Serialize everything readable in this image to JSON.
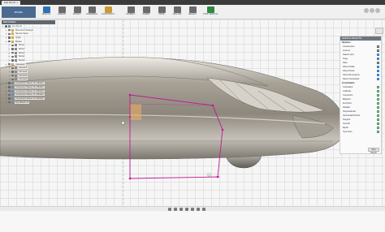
{
  "document_tab": {
    "title": "Fun Kit v9",
    "close": "×"
  },
  "toolbar": {
    "workspace": "MODEL",
    "tools": [
      {
        "label": "SKETCH",
        "icon": "sketch-icon",
        "color": "#2b72b8"
      },
      {
        "label": "CREATE",
        "icon": "create-icon",
        "color": "#6a6a6a"
      },
      {
        "label": "MODIFY",
        "icon": "modify-icon",
        "color": "#6a6a6a"
      },
      {
        "label": "ASSEMBLE",
        "icon": "assemble-icon",
        "color": "#6a6a6a"
      },
      {
        "label": "CONSTRUCT",
        "icon": "construct-icon",
        "color": "#c79a34"
      },
      {
        "label": "INSPECT",
        "icon": "inspect-icon",
        "color": "#6a6a6a"
      },
      {
        "label": "INSERT",
        "icon": "insert-icon",
        "color": "#6a6a6a"
      },
      {
        "label": "MAKE",
        "icon": "make-icon",
        "color": "#6a6a6a"
      },
      {
        "label": "ADD-INS",
        "icon": "add-ins-icon",
        "color": "#6a6a6a"
      },
      {
        "label": "SELECT",
        "icon": "select-icon",
        "color": "#6a6a6a"
      },
      {
        "label": "STOP SKETCH",
        "icon": "stop-sketch-icon",
        "color": "#2d8a3e"
      }
    ]
  },
  "browser": {
    "header": "BROWSER",
    "items": [
      {
        "label": "Fun Kit v9",
        "level": 0,
        "type": "component"
      },
      {
        "label": "Document Settings",
        "level": 1,
        "type": "folder"
      },
      {
        "label": "Named Views",
        "level": 1,
        "type": "folder"
      },
      {
        "label": "Origin",
        "level": 1,
        "type": "folder"
      },
      {
        "label": "Bodies",
        "level": 1,
        "type": "folder"
      },
      {
        "label": "Body1",
        "level": 2,
        "type": "body"
      },
      {
        "label": "Body2",
        "level": 2,
        "type": "body"
      },
      {
        "label": "Body3",
        "level": 2,
        "type": "body"
      },
      {
        "label": "Body4",
        "level": 2,
        "type": "body"
      },
      {
        "label": "Body5",
        "level": 2,
        "type": "body"
      },
      {
        "label": "Canvases",
        "level": 1,
        "type": "folder"
      },
      {
        "label": "Canvas1",
        "level": 2,
        "type": "body"
      },
      {
        "label": "Canvas2",
        "level": 2,
        "type": "body"
      },
      {
        "label": "Canvas3",
        "level": 2,
        "type": "body"
      },
      {
        "label": "Canvas4",
        "level": 2,
        "type": "body"
      },
      {
        "label": "Component Name v1:1 Body1",
        "level": 1,
        "type": "component"
      },
      {
        "label": "Component Name v1:2 Body2",
        "level": 1,
        "type": "component"
      },
      {
        "label": "Component Name v1:3 Body3",
        "level": 1,
        "type": "component"
      },
      {
        "label": "Component Name v1:4 Body4",
        "level": 1,
        "type": "component"
      },
      {
        "label": "Component Name v1:5 Body5",
        "level": 1,
        "type": "component"
      },
      {
        "label": "Top Sketch v1",
        "level": 1,
        "type": "component"
      }
    ]
  },
  "sketch_palette": {
    "header": "SKETCH PALETTE",
    "options_title": "Options",
    "options": [
      {
        "label": "Construction",
        "on": false
      },
      {
        "label": "Look At",
        "on": false
      },
      {
        "label": "Sketch Grid",
        "on": true
      },
      {
        "label": "Snap",
        "on": true
      },
      {
        "label": "Slice",
        "on": false
      },
      {
        "label": "Show Profile",
        "on": true
      },
      {
        "label": "Show Points",
        "on": true
      },
      {
        "label": "Show Dimensions",
        "on": true
      },
      {
        "label": "Show Constraints",
        "on": true
      }
    ],
    "constraints_title": "Constraints",
    "constraints": [
      "Coincident",
      "Collinear",
      "Concentric",
      "Midpoint",
      "Fix/UnFix",
      "Parallel",
      "Perpendicular",
      "Horizontal/Vertical",
      "Tangent",
      "Smooth",
      "Equal",
      "Symmetry"
    ],
    "stop_button": "Stop Sketch"
  },
  "bottom_toolbar": {
    "icons": [
      "orbit-icon",
      "pan-icon",
      "zoom-icon",
      "fit-icon",
      "display-icon",
      "grid-icon",
      "viewport-icon"
    ]
  }
}
